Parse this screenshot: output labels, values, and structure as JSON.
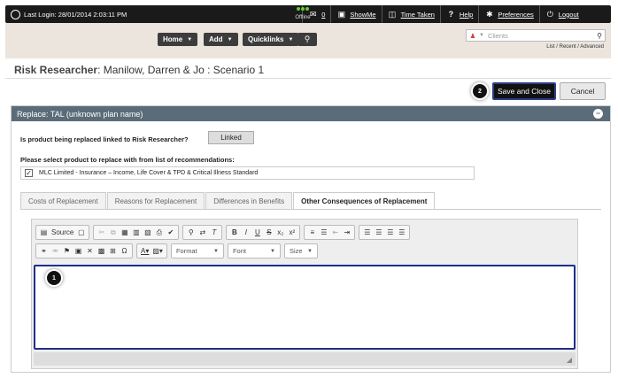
{
  "topbar": {
    "last_login": "Last Login: 28/01/2014 2:03:11 PM",
    "offline": "Offline",
    "mail_count": "0",
    "show_me": "ShowMe",
    "time_taken": "Time Taken",
    "help_icon": "?",
    "help": "Help",
    "preferences": "Preferences",
    "logout": "Logout"
  },
  "nav": {
    "home": "Home",
    "add": "Add",
    "quicklinks": "Quicklinks",
    "clients_placeholder": "Clients",
    "list_links": "List / Recent / Advanced"
  },
  "page": {
    "title_prefix": "Risk Researcher",
    "title_rest": ": Manilow, Darren & Jo : Scenario 1",
    "save_close": "Save and Close",
    "cancel": "Cancel",
    "badge_save": "2",
    "badge_editor": "1"
  },
  "panel": {
    "header": "Replace: TAL (unknown plan name)",
    "question": "Is product being replaced linked to Risk Researcher?",
    "linked_btn": "Linked",
    "select_label": "Please select product to replace with from list of recommendations:",
    "recommendation": "MLC Limited - Insurance – Income, Life Cover & TPD & Critical Illness Standard",
    "recommendation_checked": true
  },
  "tabs": [
    {
      "label": "Costs of Replacement",
      "active": false
    },
    {
      "label": "Reasons for Replacement",
      "active": false
    },
    {
      "label": "Differences in Benefits",
      "active": false
    },
    {
      "label": "Other Consequences of Replacement",
      "active": true
    }
  ],
  "editor": {
    "source": "Source",
    "format": "Format",
    "font": "Font",
    "size": "Size",
    "content": ""
  },
  "colors": {
    "topbar_bg": "#1a1a1a",
    "band_bg": "#ece5de",
    "panel_header": "#5a6c79",
    "editor_focus_border": "#1f2f8a"
  }
}
